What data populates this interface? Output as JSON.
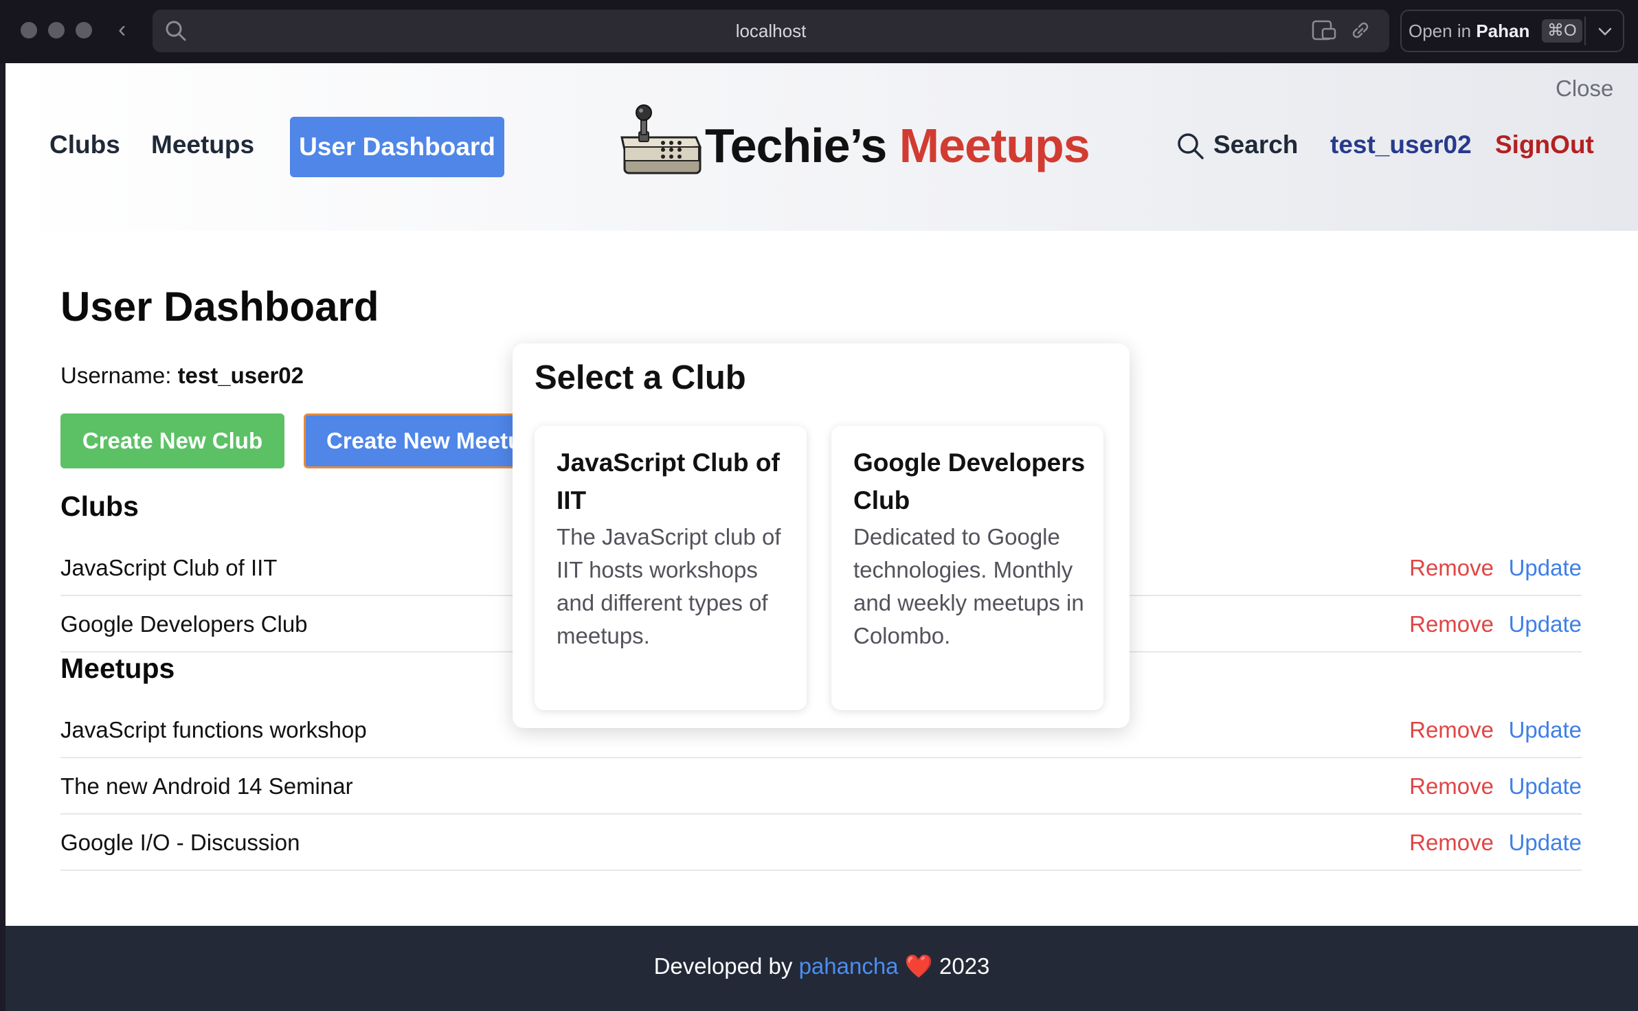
{
  "browser": {
    "url": "localhost",
    "open_in_prefix": "Open in",
    "open_in_app": "Pahan",
    "shortcut": "⌘O"
  },
  "header": {
    "close_label": "Close",
    "nav": {
      "clubs": "Clubs",
      "meetups": "Meetups",
      "user_dashboard": "User Dashboard"
    },
    "logo": {
      "part1": "Techie’s",
      "part2": "Meetups"
    },
    "search_label": "Search",
    "username": "test_user02",
    "signout_label": "SignOut"
  },
  "dashboard": {
    "title": "User Dashboard",
    "username_label": "Username:",
    "username_value": "test_user02",
    "create_club_label": "Create New Club",
    "create_meetup_label": "Create New Meetup",
    "clubs_title": "Clubs",
    "meetups_title": "Meetups",
    "remove_label": "Remove",
    "update_label": "Update",
    "clubs": [
      {
        "name": "JavaScript Club of IIT"
      },
      {
        "name": "Google Developers Club"
      }
    ],
    "meetups": [
      {
        "name": "JavaScript functions workshop"
      },
      {
        "name": "The new Android 14 Seminar"
      },
      {
        "name": "Google I/O - Discussion"
      }
    ]
  },
  "modal": {
    "title": "Select a Club",
    "clubs": [
      {
        "title": "JavaScript Club of IIT",
        "description": "The JavaScript club of IIT hosts workshops and different types of meetups."
      },
      {
        "title": "Google Developers Club",
        "description": "Dedicated to Google technologies. Monthly and weekly meetups in Colombo."
      }
    ]
  },
  "footer": {
    "prefix": "Developed by",
    "developer": "pahancha",
    "heart": "❤️",
    "year": "2023"
  },
  "colors": {
    "primary_blue": "#4f86e8",
    "green": "#5cc165",
    "logo_red": "#d23b31",
    "remove_red": "#e04545",
    "update_blue": "#3f7fe6",
    "footer_bg": "#232937"
  }
}
